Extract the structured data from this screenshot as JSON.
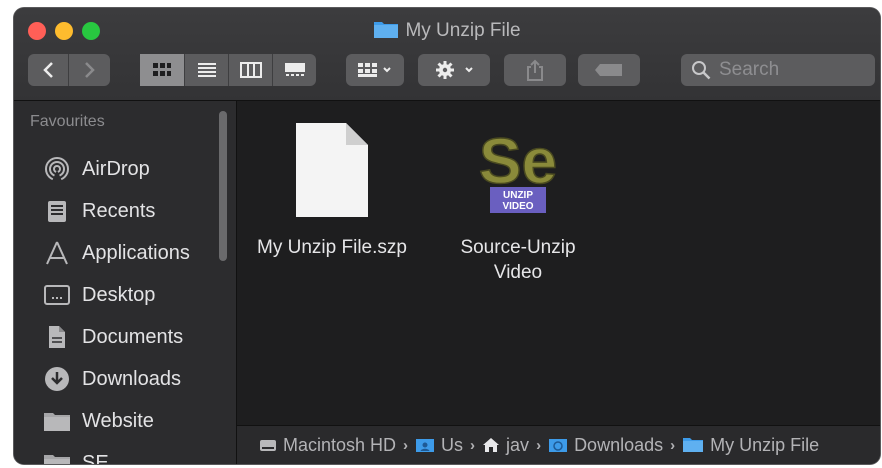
{
  "window": {
    "title": "My Unzip File"
  },
  "toolbar": {
    "back": "‹",
    "forward": "›",
    "search_placeholder": "Search"
  },
  "sidebar": {
    "heading": "Favourites",
    "items": [
      {
        "label": "AirDrop",
        "icon": "airdrop-icon"
      },
      {
        "label": "Recents",
        "icon": "recents-icon"
      },
      {
        "label": "Applications",
        "icon": "applications-icon"
      },
      {
        "label": "Desktop",
        "icon": "desktop-icon"
      },
      {
        "label": "Documents",
        "icon": "documents-icon"
      },
      {
        "label": "Downloads",
        "icon": "downloads-icon"
      },
      {
        "label": "Website",
        "icon": "folder-icon"
      },
      {
        "label": "SE",
        "icon": "folder-icon"
      }
    ]
  },
  "files": [
    {
      "name": "My Unzip File.szp",
      "icon": "document-icon"
    },
    {
      "name_line1": "Source-Unzip",
      "name_line2": "Video",
      "icon": "app-icon",
      "logo_text": "Se",
      "logo_badge1": "UNZIP",
      "logo_badge2": "VIDEO"
    }
  ],
  "pathbar": {
    "crumbs": [
      "Macintosh HD",
      "Us",
      "jav",
      "Downloads",
      "My Unzip File"
    ]
  },
  "colors": {
    "close": "#ff5f57",
    "minimize": "#febc2e",
    "maximize": "#28c840",
    "folder": "#3d9be9",
    "logo_olive": "#8a8a3a",
    "logo_badge": "#6a5fc0"
  }
}
